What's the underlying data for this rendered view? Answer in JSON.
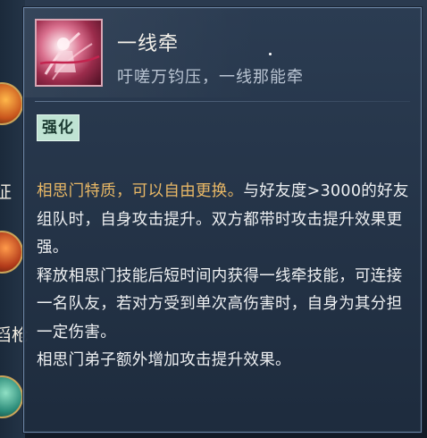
{
  "skill": {
    "title": "一线牵",
    "subtitle": "吁嗟万钧压，一线那能牵",
    "badge": "强化",
    "description": [
      {
        "highlight": "相思门特质，可以自由更换。",
        "text": "与好友度>3000的好友组队时，自身攻击提升。双方都带时攻击提升效果更强。"
      },
      {
        "highlight": "",
        "text": "释放相思门技能后短时间内获得一线牵技能，可连接一名队友，若对方受到单次高伤害时，自身为其分担一定伤害。"
      },
      {
        "highlight": "",
        "text": "相思门弟子额外增加攻击提升效果。"
      }
    ]
  },
  "side": {
    "text_1": "征",
    "text_2": "舀枪"
  },
  "colors": {
    "panel_bg": "#2b3c52",
    "highlight": "#e9b866",
    "badge_bg": "#bfe3d3",
    "icon_theme": "#d9708e"
  },
  "icons": {
    "skill_icon": "red-thread-figure-icon",
    "side_icon_1": "flame-warrior-icon",
    "side_icon_2": "fire-spear-icon",
    "side_icon_3": "jade-wind-icon"
  }
}
